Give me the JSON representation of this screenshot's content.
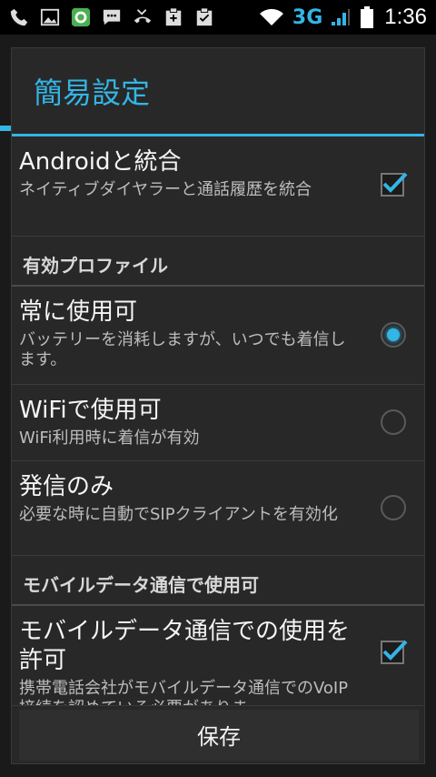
{
  "statusbar": {
    "network": "3G",
    "time": "1:36",
    "icons": [
      "phone-icon",
      "image-icon",
      "whatsapp-like-icon",
      "chat-icon",
      "missed-call-icon",
      "clipboard-icon",
      "clipboard-check-icon",
      "wifi-icon",
      "signal-icon",
      "battery-icon"
    ]
  },
  "dialog": {
    "title": "簡易設定",
    "items": [
      {
        "title": "Androidと統合",
        "subtitle": "ネイティブダイヤラーと通話履歴を統合",
        "control": "checkbox",
        "checked": true
      },
      {
        "section": "有効プロファイル"
      },
      {
        "title": "常に使用可",
        "subtitle": "バッテリーを消耗しますが、いつでも着信します。",
        "control": "radio",
        "checked": true
      },
      {
        "title": "WiFiで使用可",
        "subtitle": "WiFi利用時に着信が有効",
        "control": "radio",
        "checked": false
      },
      {
        "title": "発信のみ",
        "subtitle": "必要な時に自動でSIPクライアントを有効化",
        "control": "radio",
        "checked": false
      },
      {
        "section": "モバイルデータ通信で使用可"
      },
      {
        "title": "モバイルデータ通信での使用を許可",
        "subtitle": "携帯電話会社がモバイルデータ通信でのVoIP接続を認めている必要がありま",
        "control": "checkbox",
        "checked": true
      }
    ],
    "save_label": "保存"
  },
  "colors": {
    "accent": "#33b5e5",
    "dialog_bg": "#282828"
  }
}
